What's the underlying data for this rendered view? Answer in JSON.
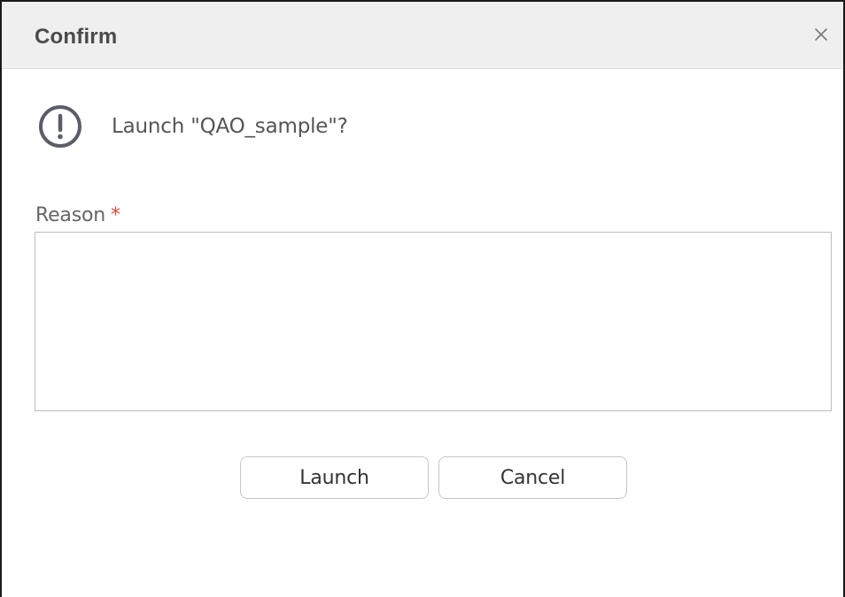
{
  "dialog": {
    "title": "Confirm",
    "close_symbol": "×",
    "icon": "alert-circle-icon",
    "message": "Launch \"QAO_sample\"?"
  },
  "form": {
    "reason_label": "Reason",
    "required_marker": "*",
    "reason_value": ""
  },
  "buttons": {
    "launch_label": "Launch",
    "cancel_label": "Cancel"
  },
  "colors": {
    "header_bg": "#efefef",
    "required": "#e0463f",
    "icon_stroke": "#5a5e66"
  }
}
